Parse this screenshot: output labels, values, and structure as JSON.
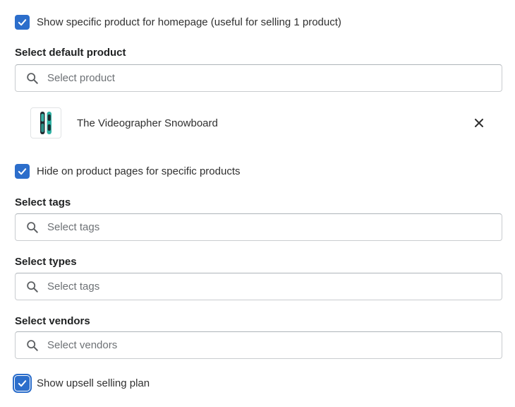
{
  "homepage_product": {
    "checkbox_label": "Show specific product for homepage (useful for selling 1 product)",
    "checked": true
  },
  "default_product": {
    "label": "Select default product",
    "placeholder": "Select product",
    "selected_item": {
      "title": "The Videographer Snowboard",
      "thumbnail_icon": "snowboard-image"
    }
  },
  "hide_on_product_pages": {
    "checkbox_label": "Hide on product pages for specific products",
    "checked": true
  },
  "tags": {
    "label": "Select tags",
    "placeholder": "Select tags"
  },
  "types": {
    "label": "Select types",
    "placeholder": "Select tags"
  },
  "vendors": {
    "label": "Select vendors",
    "placeholder": "Select vendors"
  },
  "upsell_selling_plan": {
    "checkbox_label": "Show upsell selling plan",
    "checked": true
  },
  "colors": {
    "accent": "#2c6ecb",
    "border": "#c9cccf",
    "text": "#303030"
  }
}
